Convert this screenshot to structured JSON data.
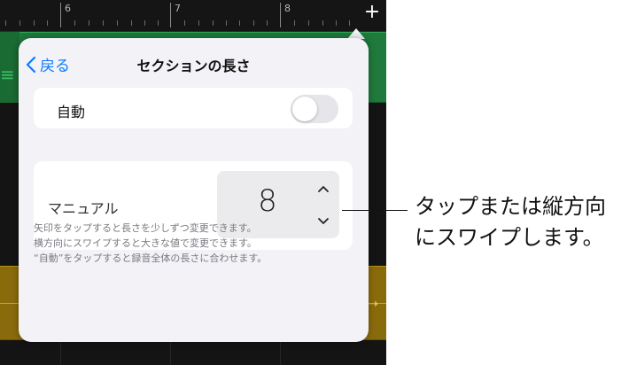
{
  "ruler": {
    "bar_numbers": [
      "6",
      "7",
      "8"
    ],
    "add_label": "+"
  },
  "popover": {
    "back_label": "戻る",
    "title": "セクションの長さ",
    "auto": {
      "label": "自動",
      "toggle_on": false
    },
    "manual": {
      "label": "マニュアル",
      "value": "8"
    },
    "footnote_lines": [
      "矢印をタップすると長さを少しずつ変更できます。",
      "横方向にスワイプすると大きな値で変更できます。",
      "“自動”をタップすると録音全体の長さに合わせます。"
    ]
  },
  "callout": {
    "lines": [
      "タップまたは縦方向",
      "にスワイプします。"
    ]
  },
  "colors": {
    "accent": "#0a7aff",
    "green_region": "#1f7a3b",
    "yellow_region": "#8a6b0c"
  }
}
